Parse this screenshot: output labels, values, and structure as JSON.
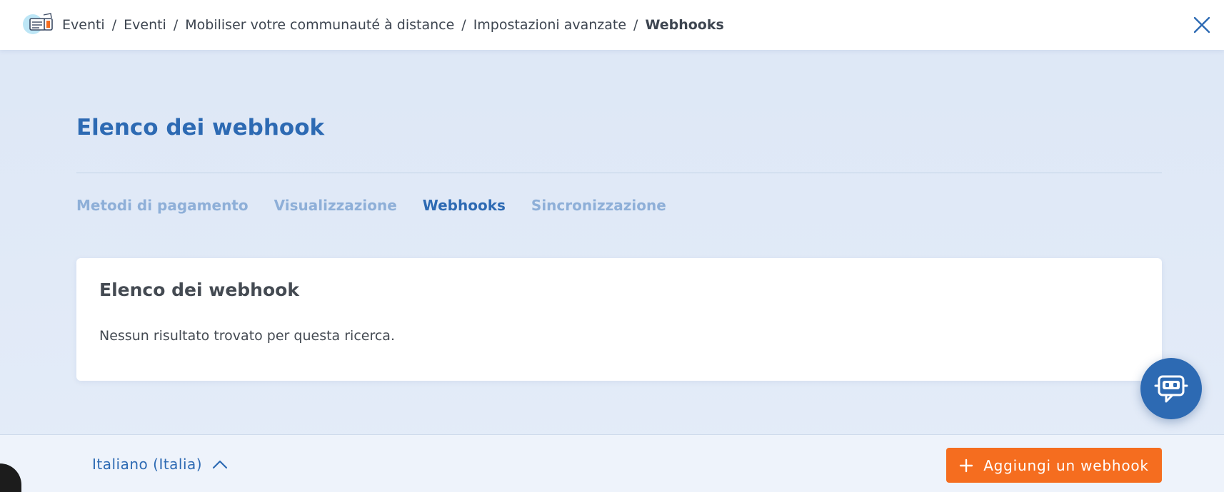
{
  "breadcrumb": {
    "items": [
      "Eventi",
      "Eventi",
      "Mobiliser votre communauté à distance",
      "Impostazioni avanzate",
      "Webhooks"
    ],
    "separator": "/"
  },
  "page": {
    "title": "Elenco dei webhook"
  },
  "tabs": {
    "items": [
      "Metodi di pagamento",
      "Visualizzazione",
      "Webhooks",
      "Sincronizzazione"
    ],
    "active": "Webhooks"
  },
  "card": {
    "title": "Elenco dei webhook",
    "empty_message": "Nessun risultato trovato per questa ricerca."
  },
  "footer": {
    "language": "Italiano (Italia)",
    "add_button_label": "Aggiungi un webhook"
  },
  "icons": {
    "app": "ticket-icon",
    "close": "close-icon",
    "chatbot": "chatbot-icon",
    "language_toggle": "chevron-up-icon",
    "add": "plus-icon"
  },
  "colors": {
    "accent": "#2d6ab3",
    "tab_inactive": "#8eafd8",
    "primary_button": "#f56d1f",
    "background": "#dfe8f7"
  }
}
